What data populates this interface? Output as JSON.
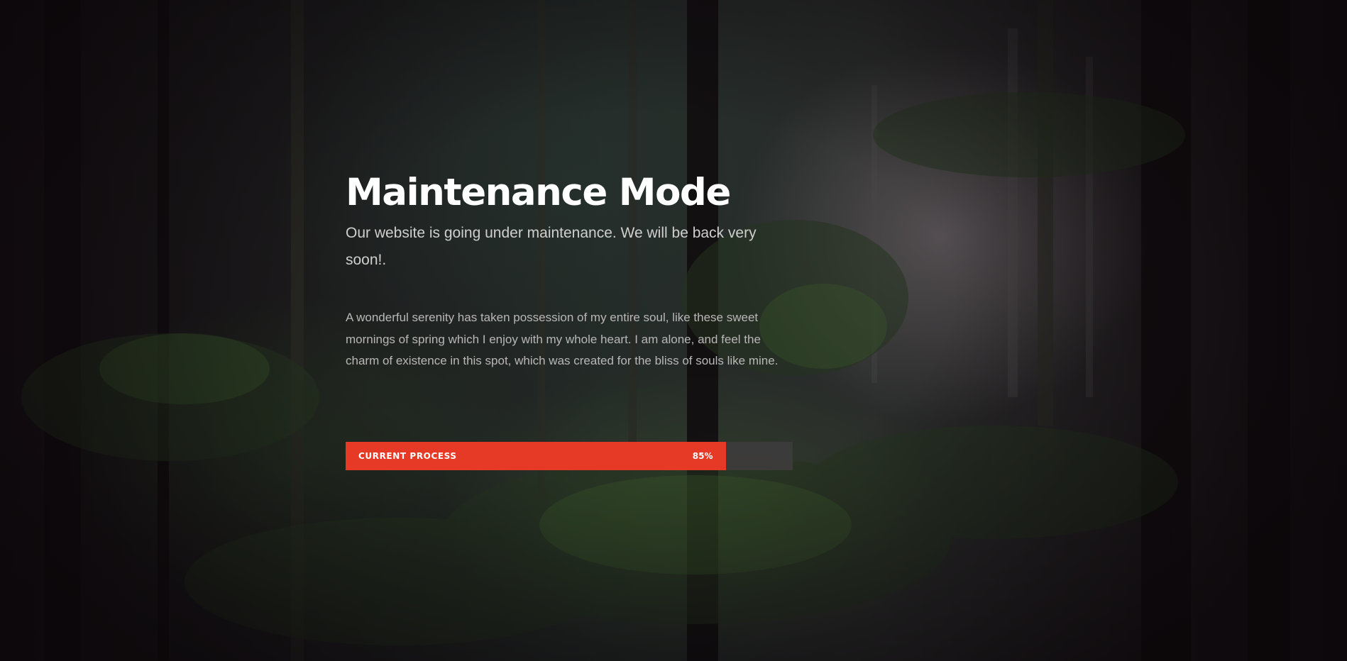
{
  "background": {
    "image": "dark-forest-photo",
    "overlay_color": "#141012"
  },
  "hero": {
    "title": "Maintenance Mode",
    "subtitle": "Our website is going under maintenance. We will be back very soon!.",
    "body": "A wonderful serenity has taken possession of my entire soul, like these sweet mornings of spring which I enjoy with my whole heart. I am alone, and feel the charm of existence in this spot, which was created for the bliss of souls like mine."
  },
  "progress": {
    "label": "CURRENT PROCESS",
    "value_text": "85%",
    "value": 0.85,
    "fill_color": "#e63a26",
    "track_color": "#3e3c3d"
  }
}
